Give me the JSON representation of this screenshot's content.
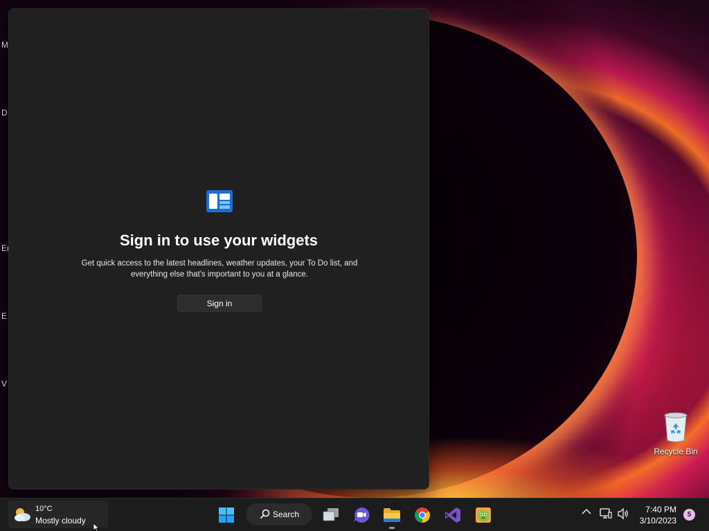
{
  "desktop": {
    "edge_labels": [
      "M",
      "D",
      "Er",
      "E",
      "V"
    ],
    "recycle_bin_label": "Recycle Bin"
  },
  "widgets_panel": {
    "heading": "Sign in to use your widgets",
    "description": "Get quick access to the latest headlines, weather updates, your To Do list, and everything else that's important to you at a glance.",
    "signin_label": "Sign in"
  },
  "taskbar": {
    "weather": {
      "temperature": "10°C",
      "condition": "Mostly cloudy",
      "icon": "partly-cloudy-icon"
    },
    "search_label": "Search",
    "apps": [
      "start-icon",
      "task-view-icon",
      "chat-icon",
      "file-explorer-icon",
      "chrome-icon",
      "visual-studio-icon",
      "game-app-icon"
    ],
    "tray": {
      "time": "7:40 PM",
      "date": "3/10/2023",
      "notification_count": "5"
    }
  },
  "colors": {
    "panel_bg": "#202020",
    "taskbar_bg": "#1c1c1c",
    "accent_blue": "#1e88e5"
  }
}
